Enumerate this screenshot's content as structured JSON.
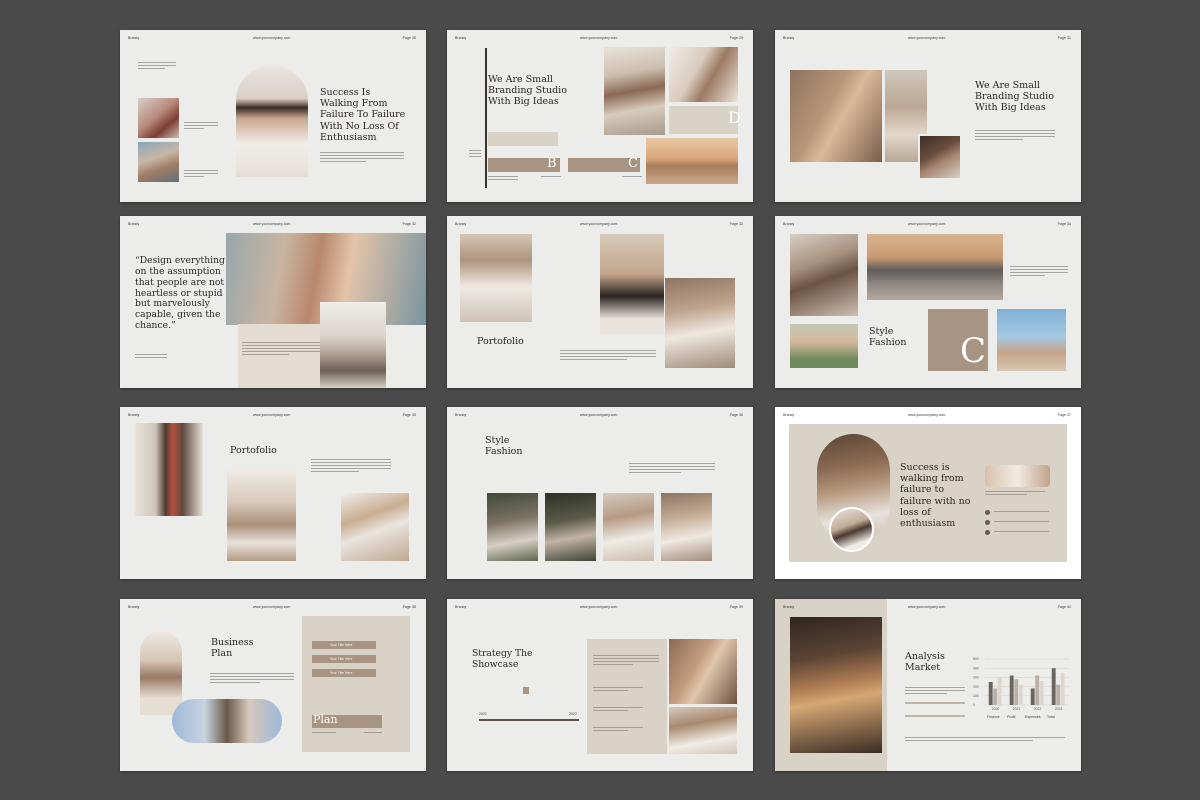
{
  "palette": {
    "background": "#4a4a4a",
    "slide": "#ececeb",
    "beige": "#d9d2c7",
    "taupe": "#a89483",
    "dark_text": "#2a2622"
  },
  "slides": [
    {
      "brand": "Brandy",
      "web": "www.yourcompany.com",
      "page": "Page 28",
      "title": "Success Is Walking From Failure To Failure With No Loss Of Enthusiasm"
    },
    {
      "brand": "Brandy",
      "web": "www.yourcompany.com",
      "page": "Page 29",
      "title": "We Are Small Branding Studio With Big Ideas",
      "letters": [
        "B",
        "C",
        "D"
      ]
    },
    {
      "brand": "Brandy",
      "web": "www.yourcompany.com",
      "page": "Page 31",
      "title": "We Are Small Branding Studio With Big Ideas"
    },
    {
      "brand": "Brandy",
      "web": "www.yourcompany.com",
      "page": "Page 32",
      "quote": "“Design everything on the assumption that people are not heartless or stupid but marvelously capable, given the chance.”"
    },
    {
      "brand": "Brandy",
      "web": "www.yourcompany.com",
      "page": "Page 33",
      "title": "Portofolio"
    },
    {
      "brand": "Brandy",
      "web": "www.yourcompany.com",
      "page": "Page 34",
      "title": "Style Fashion",
      "letter": "C"
    },
    {
      "brand": "Brandy",
      "web": "www.yourcompany.com",
      "page": "Page 35",
      "title": "Portofolio"
    },
    {
      "brand": "Brandy",
      "web": "www.yourcompany.com",
      "page": "Page 36",
      "title": "Style Fashion"
    },
    {
      "brand": "Brandy",
      "web": "www.yourcompany.com",
      "page": "Page 37",
      "title": "Success is walking from failure to failure with no loss of enthusiasm"
    },
    {
      "brand": "Brandy",
      "web": "www.yourcompany.com",
      "page": "Page 38",
      "title": "Business Plan",
      "buttons": [
        "Your Title Here",
        "Your Title Here",
        "Your Title Here"
      ],
      "plan": "Plan"
    },
    {
      "brand": "Brandy",
      "web": "www.yourcompany.com",
      "page": "Page 39",
      "title": "Strategy The Showcase",
      "slider_left": "2021",
      "slider_right": "2022"
    },
    {
      "brand": "Brandy",
      "web": "www.yourcompany.com",
      "page": "Page 40",
      "title": "Analysis Market",
      "legend": [
        "Finance",
        "Profit",
        "Expenses",
        "Total"
      ]
    }
  ],
  "chart_data": {
    "type": "bar",
    "categories": [
      "2020",
      "2021",
      "2022",
      "2023"
    ],
    "series": [
      {
        "values": [
          250,
          320,
          180,
          400
        ]
      },
      {
        "values": [
          180,
          280,
          320,
          220
        ]
      },
      {
        "values": [
          300,
          220,
          260,
          350
        ]
      }
    ],
    "y_ticks": [
      "500",
      "400",
      "300",
      "200",
      "100",
      "0"
    ],
    "ylim": [
      0,
      500
    ],
    "colors": [
      "#6b6560",
      "#b8b0a8",
      "#ddd6cf"
    ]
  }
}
